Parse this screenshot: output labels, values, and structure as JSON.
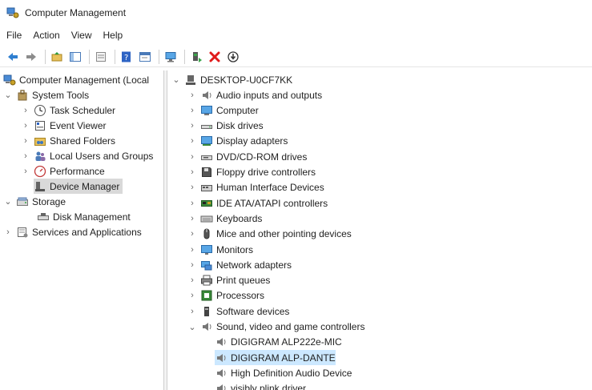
{
  "window": {
    "title": "Computer Management"
  },
  "menu": [
    "File",
    "Action",
    "View",
    "Help"
  ],
  "toolbar": {
    "icons": [
      "back-icon",
      "forward-icon",
      "up-folder-icon",
      "show-hide-tree-icon",
      "export-list-icon",
      "help-icon",
      "properties-icon",
      "monitor-icon",
      "update-driver-icon",
      "uninstall-icon",
      "disable-device-icon"
    ]
  },
  "left_tree": [
    {
      "label": "Computer Management (Local",
      "icon": "computer-management-icon"
    },
    {
      "label": "System Tools",
      "icon": "tools-icon"
    },
    {
      "label": "Task Scheduler",
      "icon": "clock-icon"
    },
    {
      "label": "Event Viewer",
      "icon": "event-viewer-icon"
    },
    {
      "label": "Shared Folders",
      "icon": "shared-folder-icon"
    },
    {
      "label": "Local Users and Groups",
      "icon": "users-icon"
    },
    {
      "label": "Performance",
      "icon": "performance-icon"
    },
    {
      "label": "Device Manager",
      "icon": "device-manager-icon"
    },
    {
      "label": "Storage",
      "icon": "storage-icon"
    },
    {
      "label": "Disk Management",
      "icon": "disk-management-icon"
    },
    {
      "label": "Services and Applications",
      "icon": "services-icon"
    }
  ],
  "right_tree": {
    "root": "DESKTOP-U0CF7KK",
    "categories": [
      {
        "label": "Audio inputs and outputs",
        "icon": "speaker-icon"
      },
      {
        "label": "Computer",
        "icon": "computer-icon"
      },
      {
        "label": "Disk drives",
        "icon": "disk-drive-icon"
      },
      {
        "label": "Display adapters",
        "icon": "display-adapter-icon"
      },
      {
        "label": "DVD/CD-ROM drives",
        "icon": "dvd-drive-icon"
      },
      {
        "label": "Floppy drive controllers",
        "icon": "floppy-icon"
      },
      {
        "label": "Human Interface Devices",
        "icon": "hid-icon"
      },
      {
        "label": "IDE ATA/ATAPI controllers",
        "icon": "ide-controller-icon"
      },
      {
        "label": "Keyboards",
        "icon": "keyboard-icon"
      },
      {
        "label": "Mice and other pointing devices",
        "icon": "mouse-icon"
      },
      {
        "label": "Monitors",
        "icon": "monitor-icon"
      },
      {
        "label": "Network adapters",
        "icon": "network-adapter-icon"
      },
      {
        "label": "Print queues",
        "icon": "printer-icon"
      },
      {
        "label": "Processors",
        "icon": "processor-icon"
      },
      {
        "label": "Software devices",
        "icon": "software-device-icon"
      },
      {
        "label": "Sound, video and game controllers",
        "icon": "speaker-icon"
      }
    ],
    "sound_children": [
      {
        "label": "DIGIGRAM ALP222e-MIC",
        "icon": "speaker-icon"
      },
      {
        "label": "DIGIGRAM ALP-DANTE",
        "icon": "speaker-icon"
      },
      {
        "label": "High Definition Audio Device",
        "icon": "speaker-icon"
      },
      {
        "label": "visibly plink driver",
        "icon": "speaker-icon"
      }
    ]
  },
  "colors": {
    "selection_gray": "#d9d9d9",
    "selection_blue": "#cce8ff",
    "accent": "#1e73be"
  }
}
